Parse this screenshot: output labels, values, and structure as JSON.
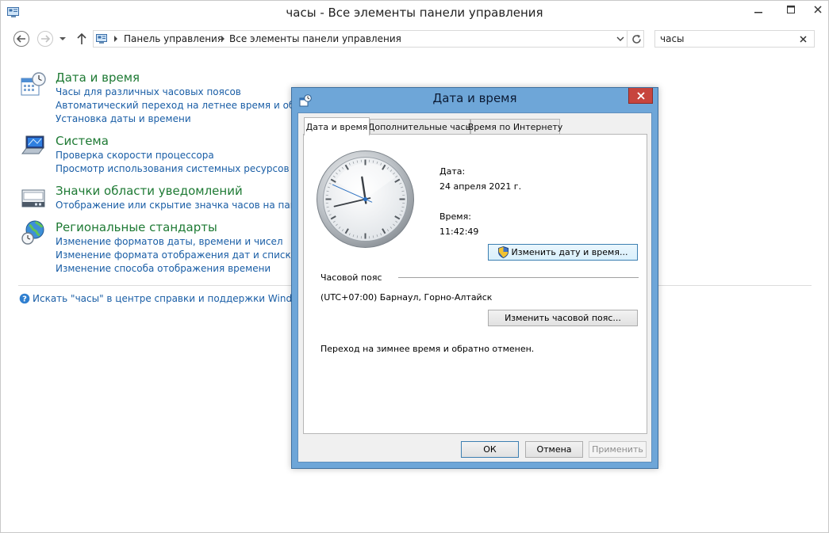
{
  "window": {
    "title": "часы - Все элементы панели управления"
  },
  "address": {
    "crumbs": [
      "Панель управления",
      "Все элементы панели управления"
    ]
  },
  "search": {
    "value": "часы"
  },
  "categories": [
    {
      "title": "Дата и время",
      "icon": "datetime-icon",
      "links": [
        "Часы для различных часовых поясов",
        "Автоматический переход на летнее время и обратно",
        "Установка даты и времени"
      ]
    },
    {
      "title": "Система",
      "icon": "system-icon",
      "links": [
        "Проверка скорости процессора",
        "Просмотр использования системных ресурсов в диспетчере задач"
      ]
    },
    {
      "title": "Значки области уведомлений",
      "icon": "notification-icons-icon",
      "links": [
        "Отображение или скрытие значка часов на панели задач"
      ]
    },
    {
      "title": "Региональные стандарты",
      "icon": "region-globe-icon",
      "links": [
        "Изменение форматов даты, времени и чисел",
        "Изменение формата отображения дат и списков",
        "Изменение способа отображения времени"
      ]
    }
  ],
  "help_link": "Искать \"часы\" в центре справки и поддержки Windows",
  "dialog": {
    "title": "Дата и время",
    "tabs": [
      "Дата и время",
      "Дополнительные часы",
      "Время по Интернету"
    ],
    "active_tab": "Дата и время",
    "date_label": "Дата:",
    "date_value": "24 апреля 2021 г.",
    "time_label": "Время:",
    "time_value": "11:42:49",
    "change_datetime_button": "Изменить дату и время...",
    "timezone_label": "Часовой пояс",
    "timezone_value": "(UTC+07:00) Барнаул, Горно-Алтайск",
    "change_timezone_button": "Изменить часовой пояс...",
    "dst_text": "Переход на зимнее время и обратно отменен.",
    "buttons": {
      "ok": "ОК",
      "cancel": "Отмена",
      "apply": "Применить"
    }
  }
}
